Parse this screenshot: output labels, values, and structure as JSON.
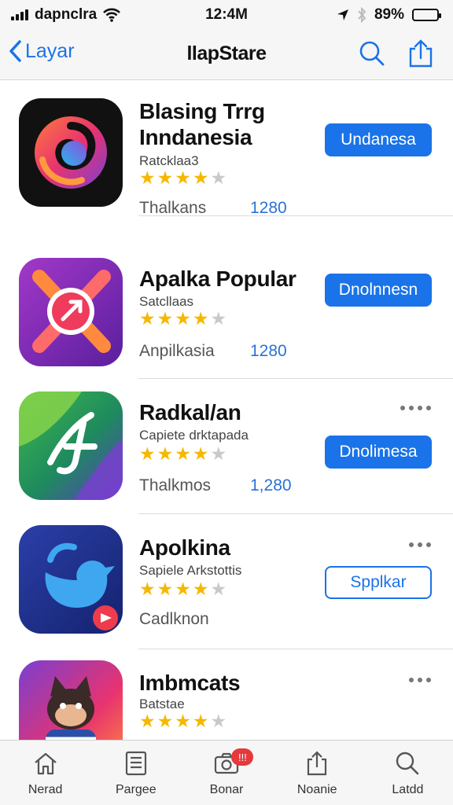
{
  "status_bar": {
    "carrier": "dapnclra",
    "time": "12:4M",
    "battery": "89%",
    "battery_level": 0.89
  },
  "nav": {
    "back_label": "Layar",
    "title": "llapStare"
  },
  "apps": [
    {
      "name_line1": "Blasing Trrg",
      "name_line2": "Inndanesia",
      "subtitle": "Ratcklaa3",
      "rating": 4,
      "meta": "Thalkans",
      "count": "1280",
      "button_label": "Undanesa",
      "icon": "swirl-app-icon"
    },
    {
      "name_line1": "Apalka Popular",
      "subtitle": "Satcllaas",
      "rating": 4,
      "meta": "Anpilkasia",
      "count": "1280",
      "button_label": "Dnolnnesn",
      "icon": "compass-arrow-app-icon"
    },
    {
      "name_line1": "Radkal/an",
      "subtitle": "Capiete drktapada",
      "rating": 4,
      "meta": "Thalkmos",
      "count": "1,280",
      "button_label": "Dnolimesa",
      "icon": "music-note-app-icon"
    },
    {
      "name_line1": "Apolkina",
      "subtitle": "Sapiele Arkstottis",
      "rating": 4,
      "meta": "Cadlknon",
      "count": "",
      "button_label": "Spplkar",
      "icon": "bird-app-icon"
    },
    {
      "name_line1": "Imbmcats",
      "subtitle": "Batstae",
      "rating": 4,
      "meta": "",
      "count": "",
      "button_label": "",
      "icon": "cat-character-app-icon"
    }
  ],
  "tabs": [
    {
      "label": "Nerad",
      "icon": "home-icon"
    },
    {
      "label": "Pargee",
      "icon": "list-icon"
    },
    {
      "label": "Bonar",
      "icon": "camera-icon",
      "badge": "!!!"
    },
    {
      "label": "Noanie",
      "icon": "share-icon"
    },
    {
      "label": "Latdd",
      "icon": "search-icon"
    }
  ],
  "colors": {
    "accent": "#1a73e8",
    "star": "#f5b800",
    "badge": "#e5393b"
  }
}
